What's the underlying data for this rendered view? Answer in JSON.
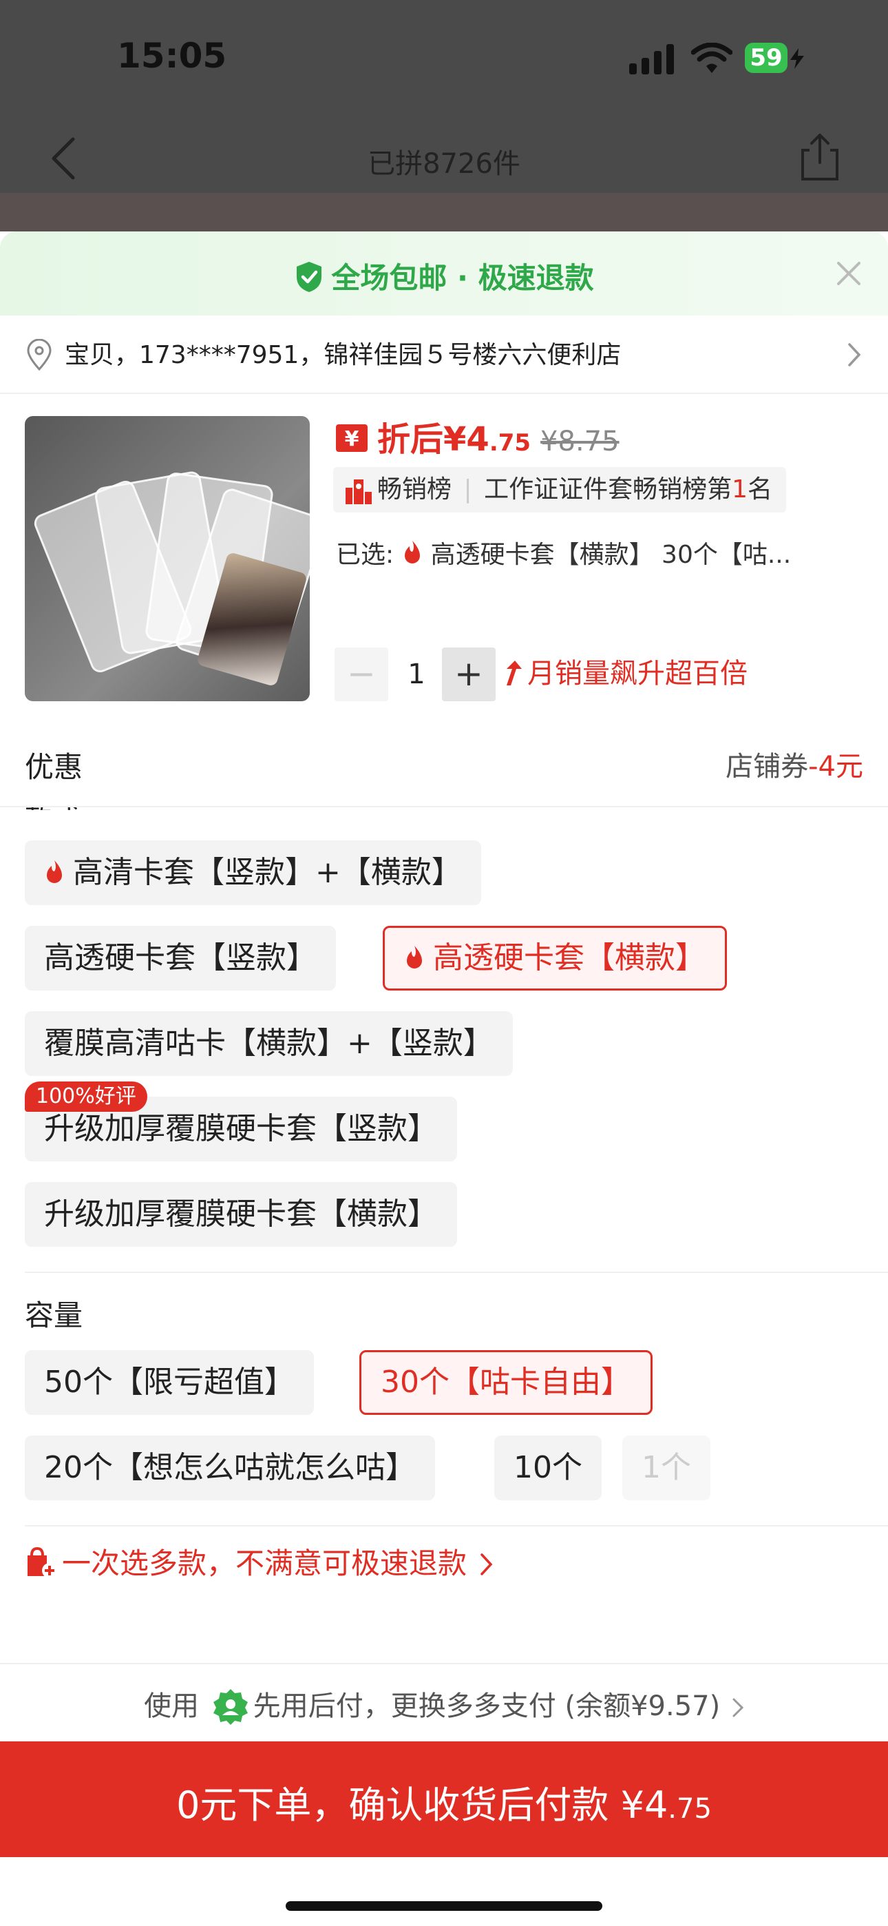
{
  "status_bar": {
    "time": "15:05",
    "battery": "59"
  },
  "header": {
    "title": "已拼8726件"
  },
  "banner": {
    "text": "全场包邮 · 极速退款"
  },
  "address": {
    "text": "宝贝，173****7951，锦祥佳园５号楼六六便利店"
  },
  "product": {
    "price_label": "折后¥4",
    "price_decimal": ".75",
    "original_price": "¥8.75",
    "rank_tag": "畅销榜",
    "rank_text_pre": "工作证证件套畅销榜第",
    "rank_number": "1",
    "rank_text_post": "名",
    "selected_label": "已选:",
    "selected_value": "高透硬卡套【横款】 30个【咕...",
    "quantity": "1",
    "sales_trend": "月销量飙升超百倍"
  },
  "promo": {
    "title": "优惠",
    "label": "店铺券",
    "value": "-4元"
  },
  "style_group": {
    "label": "款式",
    "options": [
      {
        "label": "高清卡套【竖款】+【横款】",
        "hot": true
      },
      {
        "label": "高透硬卡套【竖款】",
        "hot": false
      },
      {
        "label": "高透硬卡套【横款】",
        "hot": true,
        "selected": true
      },
      {
        "label": "覆膜高清咕卡【横款】+【竖款】",
        "hot": false
      },
      {
        "label": "升级加厚覆膜硬卡套【竖款】",
        "hot": false,
        "badge": "100%好评"
      },
      {
        "label": "升级加厚覆膜硬卡套【横款】",
        "hot": false
      }
    ]
  },
  "capacity_group": {
    "label": "容量",
    "options": [
      {
        "label": "50个【限亏超值】"
      },
      {
        "label": "30个【咕卡自由】",
        "selected": true
      },
      {
        "label": "20个【想怎么咕就怎么咕】"
      },
      {
        "label": "10个"
      },
      {
        "label": "1个",
        "disabled": true
      }
    ]
  },
  "multi_tip": "一次选多款，不满意可极速退款",
  "payment": {
    "use": "使用",
    "text": "先用后付，更换多多支付 (余额¥9.57)"
  },
  "cta": {
    "text": "0元下单，确认收货后付款 ¥4",
    "decimal": ".75"
  },
  "colors": {
    "accent": "#e02e24",
    "green": "#2fa84a"
  }
}
